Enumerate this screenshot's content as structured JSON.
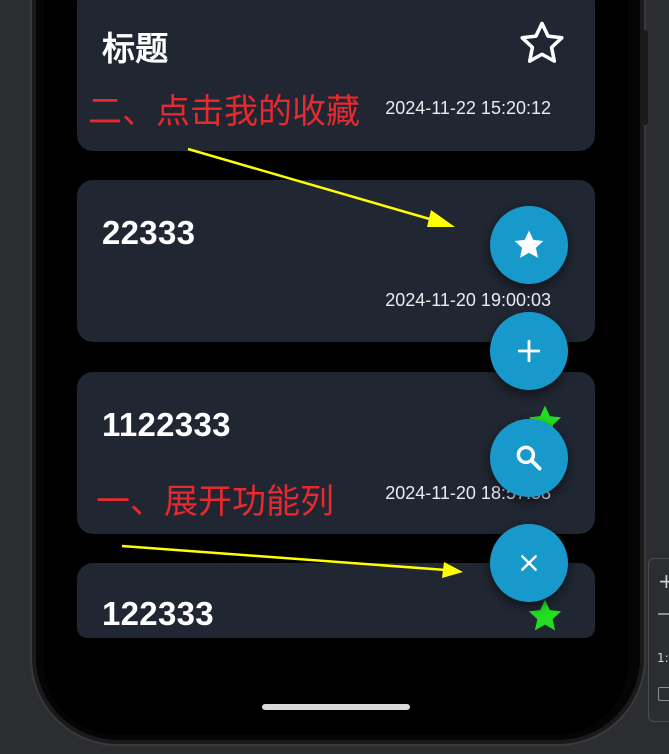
{
  "notes": [
    {
      "title": "标题",
      "date": "2024-11-22 15:20:12",
      "favorite": false
    },
    {
      "title": "22333",
      "date": "2024-11-20 19:00:03",
      "favorite": false
    },
    {
      "title": "1122333",
      "date": "2024-11-20 18:57:58",
      "favorite": true
    },
    {
      "title": "122333",
      "date": "",
      "favorite": true
    }
  ],
  "fab_actions": [
    {
      "icon": "star-icon",
      "action": "我的收藏"
    },
    {
      "icon": "plus-icon",
      "action": "添加"
    },
    {
      "icon": "search-icon",
      "action": "搜索"
    },
    {
      "icon": "close-icon",
      "action": "收起"
    }
  ],
  "annotations": {
    "step2": "二、点击我的收藏",
    "step1": "一、展开功能列"
  },
  "colors": {
    "card_bg": "#202632",
    "fab_bg": "#1899cc",
    "annotation_text": "#e8292d",
    "arrow": "#ffff00",
    "favorite_star": "#22dd22"
  }
}
